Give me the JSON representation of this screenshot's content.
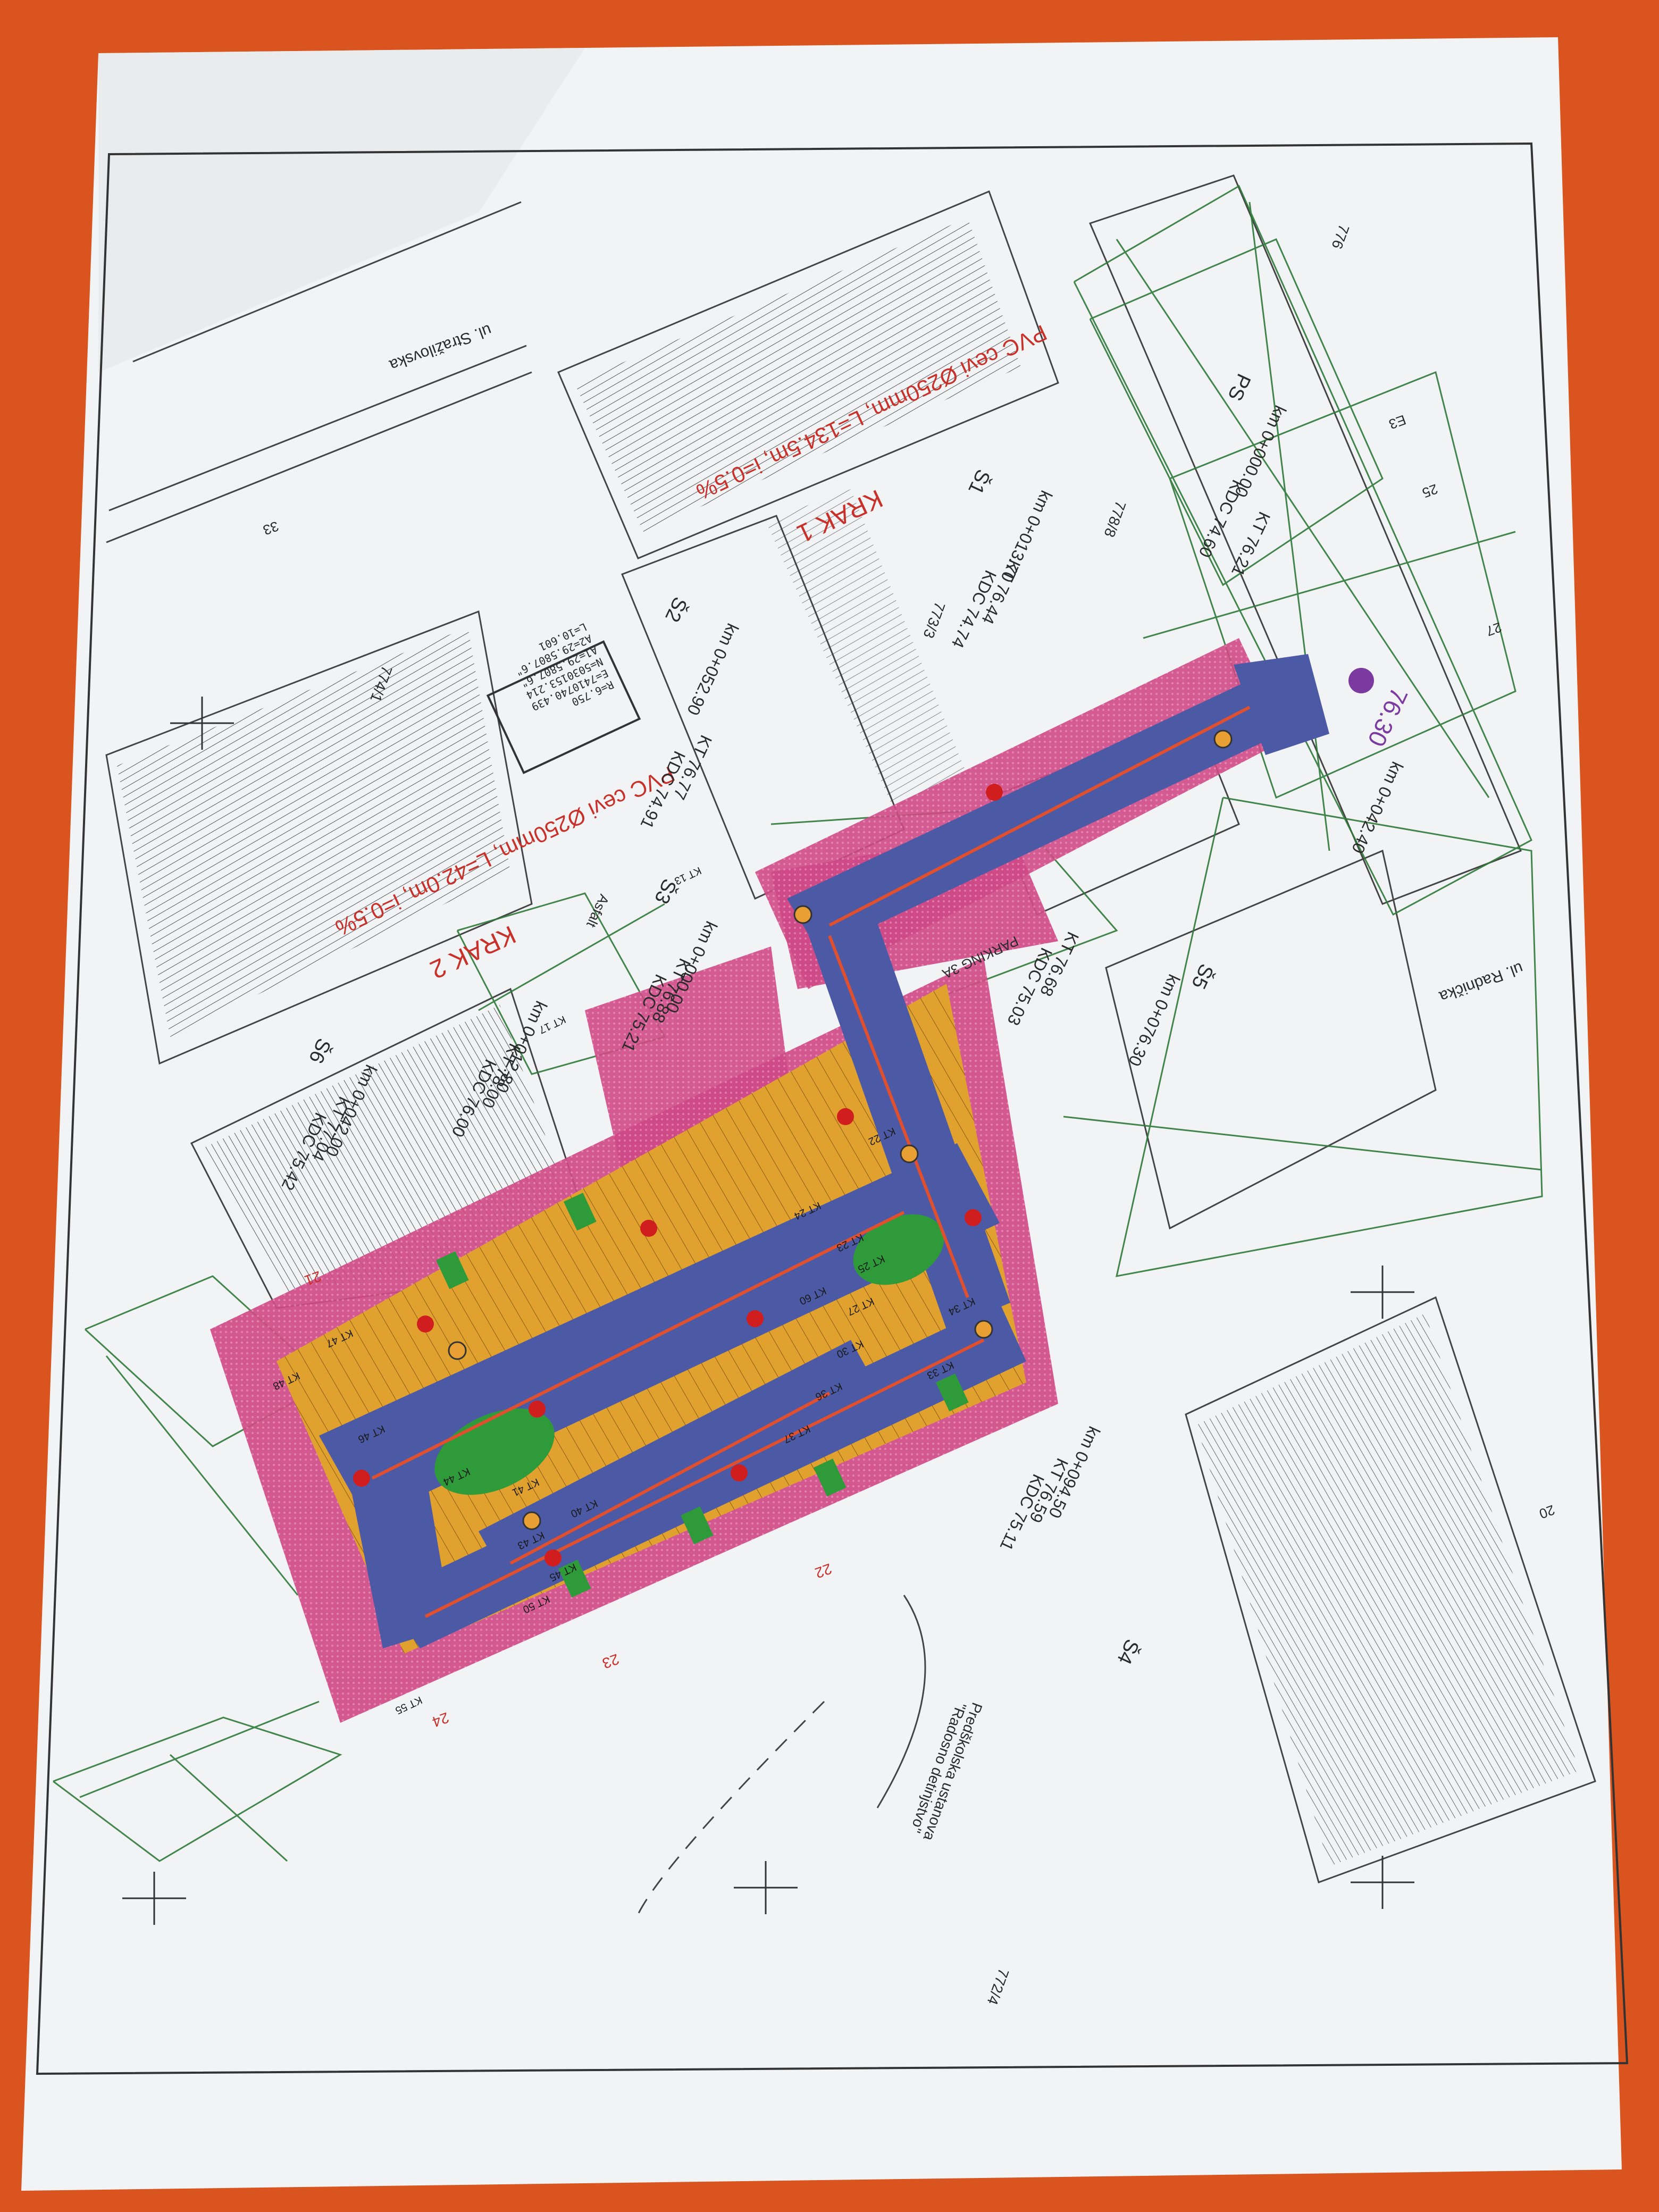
{
  "photo": {
    "background_color": "#d9541e",
    "sheet_color": "#f2f3f5"
  },
  "plan": {
    "street_labels": {
      "top": "ul. Stražilovska",
      "right": "ul. Radnička"
    },
    "pipe_labels": {
      "krak1": "KRAK 1",
      "krak1_pipe": "PVC cevi Ø250mm, L=134.5m, i=0.5%",
      "krak2": "KRAK 2",
      "krak2_pipe": "PVC cevi Ø250mm, L=42.0m, i=0.5%"
    },
    "manholes": {
      "s1": {
        "id": "Š1",
        "km": "km 0+013.70",
        "kt": "KT 76.44",
        "kdc": "KDC 74.74"
      },
      "s2": {
        "id": "Š2",
        "km": "km 0+052.90",
        "kt": "KT 76.77",
        "kdc": "KDC 74.91"
      },
      "s3": {
        "id": "Š3",
        "km": "km 0+000.00",
        "kt": "KT 76.88",
        "kdc": "KDC 75.21"
      },
      "s4": {
        "id": "Š4",
        "km": "km 0+094.50",
        "kt": "KT 76.59",
        "kdc": "KDC 75.11"
      },
      "s5": {
        "id": "Š5",
        "km": "km 0+076.30",
        "kt": "KT 76.68",
        "kdc": "KDC 75.03"
      },
      "s6": {
        "id": "Š6",
        "km": "km 0+042.00",
        "kt": "KT 77.04",
        "kdc": "KDC 75.42"
      },
      "s7": {
        "km": "km 0+012.80",
        "kt": "KT 78.00",
        "kdc": "KDC 76.00"
      },
      "ps": {
        "id": "PS",
        "km": "km 0+000.00",
        "kt": "KT 76.21",
        "kdc": "KDC 74.60"
      }
    },
    "parcel_labels": [
      "772/4",
      "773/3",
      "778/8",
      "774/1",
      "776",
      "33",
      "20",
      "24",
      "21",
      "22",
      "23",
      "27",
      "25",
      "E3"
    ],
    "coordinate_box": [
      "R=6.750",
      "E=7410740.439",
      "N=5030153.214",
      "A1=29.5807.6\"",
      "A2=29.5807.6\"",
      "L=10.601"
    ],
    "misc": {
      "asfalt": "Asfalt",
      "parking": "PARKING 3A",
      "level": "76.30",
      "school_line1": "Predškolska ustanova",
      "school_line2": "\"Radosno detinjstvo\"",
      "station": "km 0+042.40"
    },
    "kt_tags": [
      "KT 13",
      "KT 17",
      "KT 22",
      "KT 23",
      "KT 24",
      "KT 25",
      "KT 27",
      "KT 30",
      "KT 33",
      "KT 34",
      "KT 36",
      "KT 37",
      "KT 40",
      "KT 41",
      "KT 43",
      "KT 44",
      "KT 45",
      "KT 46",
      "KT 47",
      "KT 48",
      "KT 50",
      "KT 55",
      "KT 60"
    ],
    "colors": {
      "road": "#4c5aa6",
      "zone": "#cf4a86",
      "parking": "#e0a12f",
      "grass": "#2f9a3a",
      "survey": "#2f7a3a",
      "text_red": "#c8302a"
    }
  }
}
